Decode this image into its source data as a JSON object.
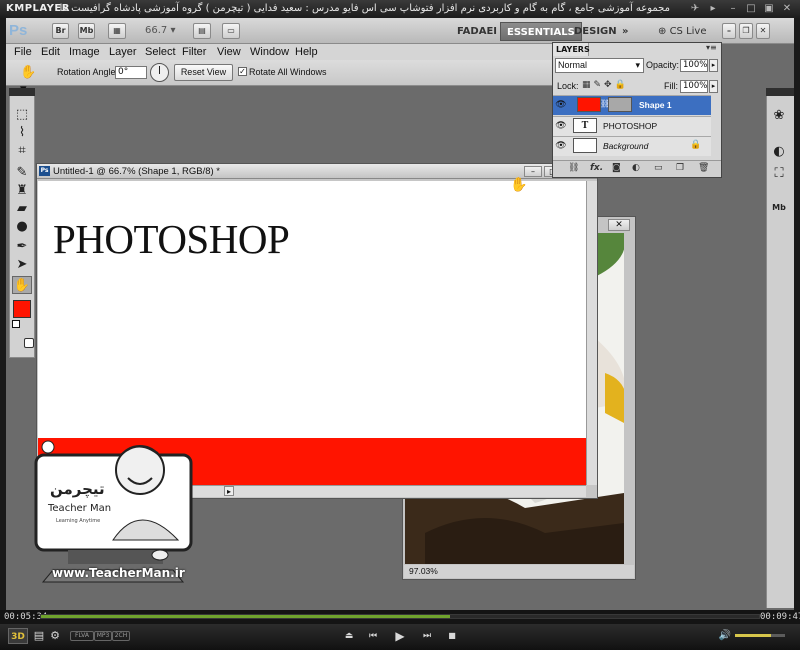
{
  "player": {
    "logo": "KMPLAYER",
    "title": "مجموعه آموزشی جامع ، گام به گام و کاربردی نرم افزار فتوشاپ سی اس فایو  مدرس : سعید فدایی ( تیچرمن ) گروه آموزشی پادشاه گرافیست ها",
    "time_elapsed": "00:05:34",
    "time_total": "00:09:47",
    "progress": 0.57,
    "volume": 0.72,
    "pills": [
      "FLVA",
      "MP3",
      "2CH"
    ],
    "badge_3d": "3D"
  },
  "photoshop": {
    "logo": "Ps",
    "app_bar": {
      "br_icon": "Br",
      "mb_icon": "Mb",
      "zoom": "66.7",
      "workspace_user": "FADAEI",
      "workspace_active": "ESSENTIALS",
      "workspace_design": "DESIGN",
      "more": "»",
      "cs_live": "CS Live"
    },
    "menu": [
      "File",
      "Edit",
      "Image",
      "Layer",
      "Select",
      "Filter",
      "View",
      "Window",
      "Help"
    ],
    "options": {
      "rotation_label": "Rotation Angle:",
      "rotation_value": "0°",
      "reset_label": "Reset View",
      "rotate_all_label": "Rotate All Windows",
      "rotate_all_checked": true
    },
    "layers_panel": {
      "tab": "LAYERS",
      "blend_mode": "Normal",
      "opacity_label": "Opacity:",
      "opacity_value": "100%",
      "lock_label": "Lock:",
      "fill_label": "Fill:",
      "fill_value": "100%",
      "layers": [
        {
          "name": "Shape 1",
          "selected": true,
          "kind": "shape"
        },
        {
          "name": "PHOTOSHOP",
          "selected": false,
          "kind": "text"
        },
        {
          "name": "Background",
          "selected": false,
          "kind": "background"
        }
      ],
      "footer_icons": [
        "link-icon",
        "fx-icon",
        "mask-icon",
        "adjustment-icon",
        "group-icon",
        "new-layer-icon",
        "trash-icon"
      ]
    },
    "document": {
      "title": "Untitled-1 @ 66.7% (Shape 1, RGB/8) *",
      "canvas_text": "PHOTOSHOP",
      "shape_color": "#ff1400"
    },
    "eagle_window": {
      "zoom": "97.03%"
    }
  },
  "watermark": {
    "brand_fa": "تیچرمن",
    "brand_en": "Teacher Man",
    "tagline": "Learning Anytime",
    "url": "www.TeacherMan.ir"
  }
}
